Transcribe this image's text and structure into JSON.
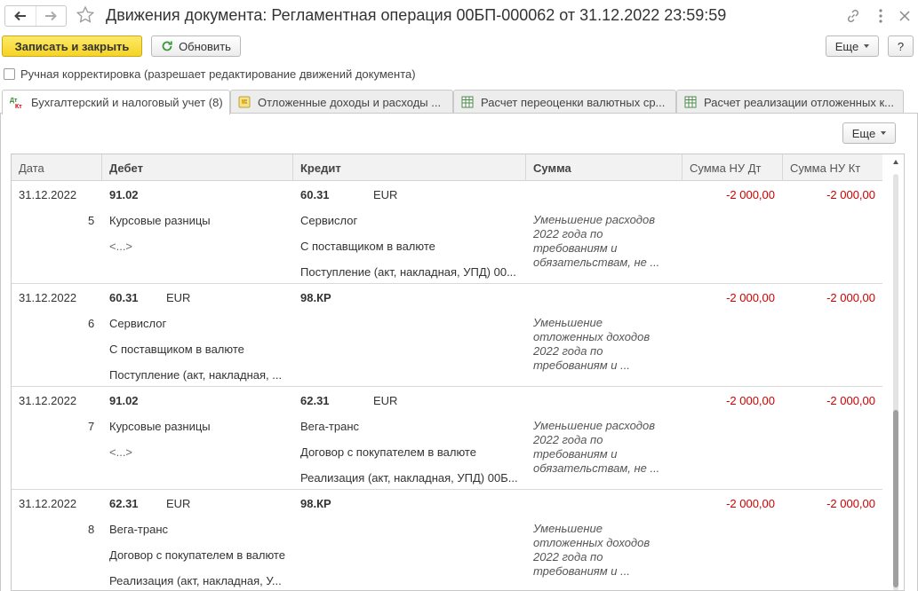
{
  "window": {
    "title": "Движения документа: Регламентная операция 00БП-000062 от 31.12.2022 23:59:59"
  },
  "toolbar": {
    "save_close_label": "Записать и закрыть",
    "refresh_label": "Обновить",
    "more_label": "Еще",
    "help_label": "?"
  },
  "manual_correction": {
    "label": "Ручная корректировка (разрешает редактирование движений документа)",
    "checked": false
  },
  "tabs": [
    {
      "label": "Бухгалтерский и налоговый учет (8)",
      "active": true
    },
    {
      "label": "Отложенные доходы и расходы ...",
      "active": false
    },
    {
      "label": "Расчет переоценки валютных ср...",
      "active": false
    },
    {
      "label": "Расчет реализации отложенных к...",
      "active": false
    }
  ],
  "panel": {
    "more_label": "Еще"
  },
  "grid": {
    "columns": [
      "Дата",
      "Дебет",
      "Кредит",
      "Сумма",
      "Сумма НУ Дт",
      "Сумма НУ Кт"
    ],
    "rows": [
      {
        "date": "31.12.2022",
        "num": "5",
        "debit_account": "91.02",
        "debit_currency": "",
        "debit_sub": [
          "Курсовые разницы",
          "<...>",
          ""
        ],
        "credit_account": "60.31",
        "credit_currency": "EUR",
        "credit_sub": [
          "Сервислог",
          "С поставщиком в валюте",
          "Поступление (акт, накладная, УПД) 00..."
        ],
        "amount_note": "Уменьшение расходов 2022 года по требованиям и обязательствам, не ...",
        "nu_dt": "-2 000,00",
        "nu_kt": "-2 000,00"
      },
      {
        "date": "31.12.2022",
        "num": "6",
        "debit_account": "60.31",
        "debit_currency": "EUR",
        "debit_sub": [
          "Сервислог",
          "С поставщиком в валюте",
          "Поступление (акт, накладная, ..."
        ],
        "credit_account": "98.КР",
        "credit_currency": "",
        "credit_sub": [
          "",
          "",
          ""
        ],
        "amount_note": "Уменьшение отложенных доходов 2022 года по требованиям и ...",
        "nu_dt": "-2 000,00",
        "nu_kt": "-2 000,00"
      },
      {
        "date": "31.12.2022",
        "num": "7",
        "debit_account": "91.02",
        "debit_currency": "",
        "debit_sub": [
          "Курсовые разницы",
          "<...>",
          ""
        ],
        "credit_account": "62.31",
        "credit_currency": "EUR",
        "credit_sub": [
          "Вега-транс",
          "Договор с покупателем в валюте",
          "Реализация (акт, накладная, УПД) 00Б..."
        ],
        "amount_note": "Уменьшение расходов 2022 года по требованиям и обязательствам, не ...",
        "nu_dt": "-2 000,00",
        "nu_kt": "-2 000,00"
      },
      {
        "date": "31.12.2022",
        "num": "8",
        "debit_account": "62.31",
        "debit_currency": "EUR",
        "debit_sub": [
          "Вега-транс",
          "Договор с покупателем в валюте",
          "Реализация (акт, накладная, У..."
        ],
        "credit_account": "98.КР",
        "credit_currency": "",
        "credit_sub": [
          "",
          "",
          ""
        ],
        "amount_note": "Уменьшение отложенных доходов 2022 года по требованиям и ...",
        "nu_dt": "-2 000,00",
        "nu_kt": "-2 000,00"
      }
    ]
  },
  "colors": {
    "primary_button": "#f5d425",
    "negative_amount": "#d00000"
  }
}
